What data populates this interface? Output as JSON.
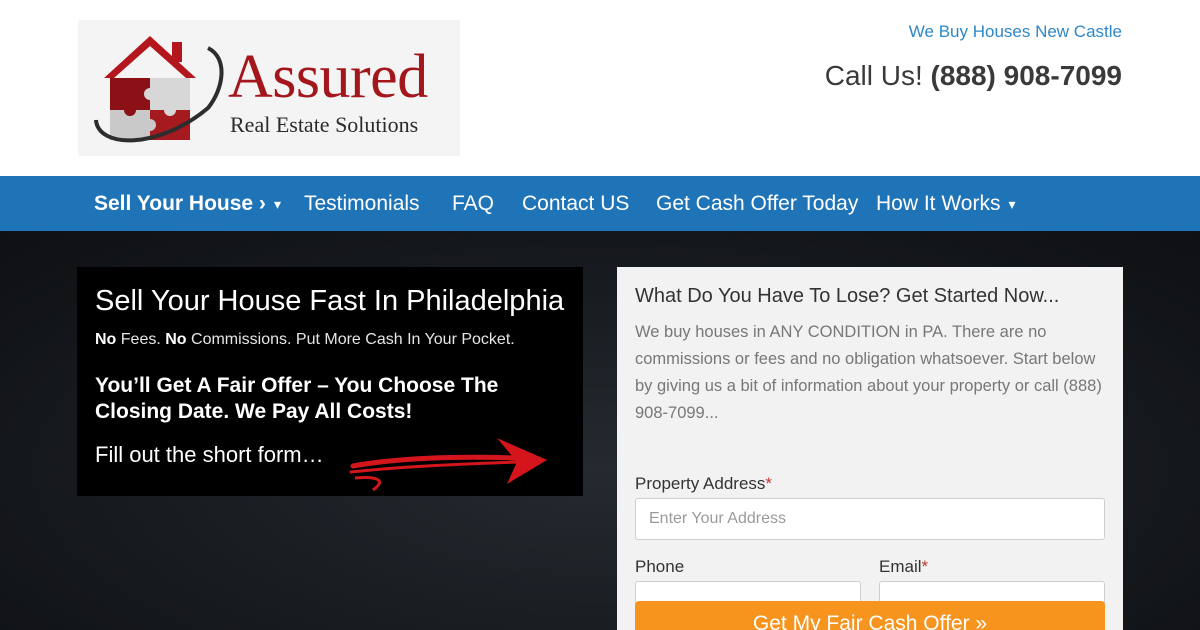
{
  "header": {
    "logo": {
      "title": "Assured",
      "subtitle": "Real Estate Solutions"
    },
    "top_link": "We Buy Houses New Castle",
    "call_prefix": "Call Us!",
    "phone": "(888) 908-7099"
  },
  "nav": {
    "items": [
      {
        "label": "Sell Your House ›",
        "has_dropdown": true
      },
      {
        "label": "Testimonials"
      },
      {
        "label": "FAQ"
      },
      {
        "label": "Contact US"
      },
      {
        "label": "Get Cash Offer Today"
      },
      {
        "label": "How It Works",
        "has_dropdown": true
      }
    ],
    "caret": "▾"
  },
  "hero": {
    "title": "Sell Your House Fast In Philadelphia",
    "sub_no1": "No",
    "sub_text1": " Fees. ",
    "sub_no2": "No",
    "sub_text2": " Commissions. Put More Cash In Your Pocket.",
    "bold_text": "You’ll Get A Fair Offer – You Choose The Closing Date. We Pay All Costs!",
    "fill_text": "Fill out the short form…"
  },
  "form": {
    "title": "What Do You Have To Lose? Get Started Now...",
    "description": "We buy houses in ANY CONDITION in PA. There are no commissions or fees and no obligation whatsoever. Start below by giving us a bit of information about your property or call (888) 908-7099...",
    "address_label": "Property Address",
    "address_placeholder": "Enter Your Address",
    "phone_label": "Phone",
    "email_label": "Email",
    "required_mark": "*",
    "submit_label": "Get My Fair Cash Offer »"
  },
  "colors": {
    "nav_bg": "#1f73b7",
    "link": "#2e87c8",
    "brand_red": "#a3171c",
    "submit_bg": "#f7941d"
  },
  "icons": [
    "house-puzzle-logo-icon",
    "red-arrow-icon",
    "chevron-down-icon"
  ]
}
